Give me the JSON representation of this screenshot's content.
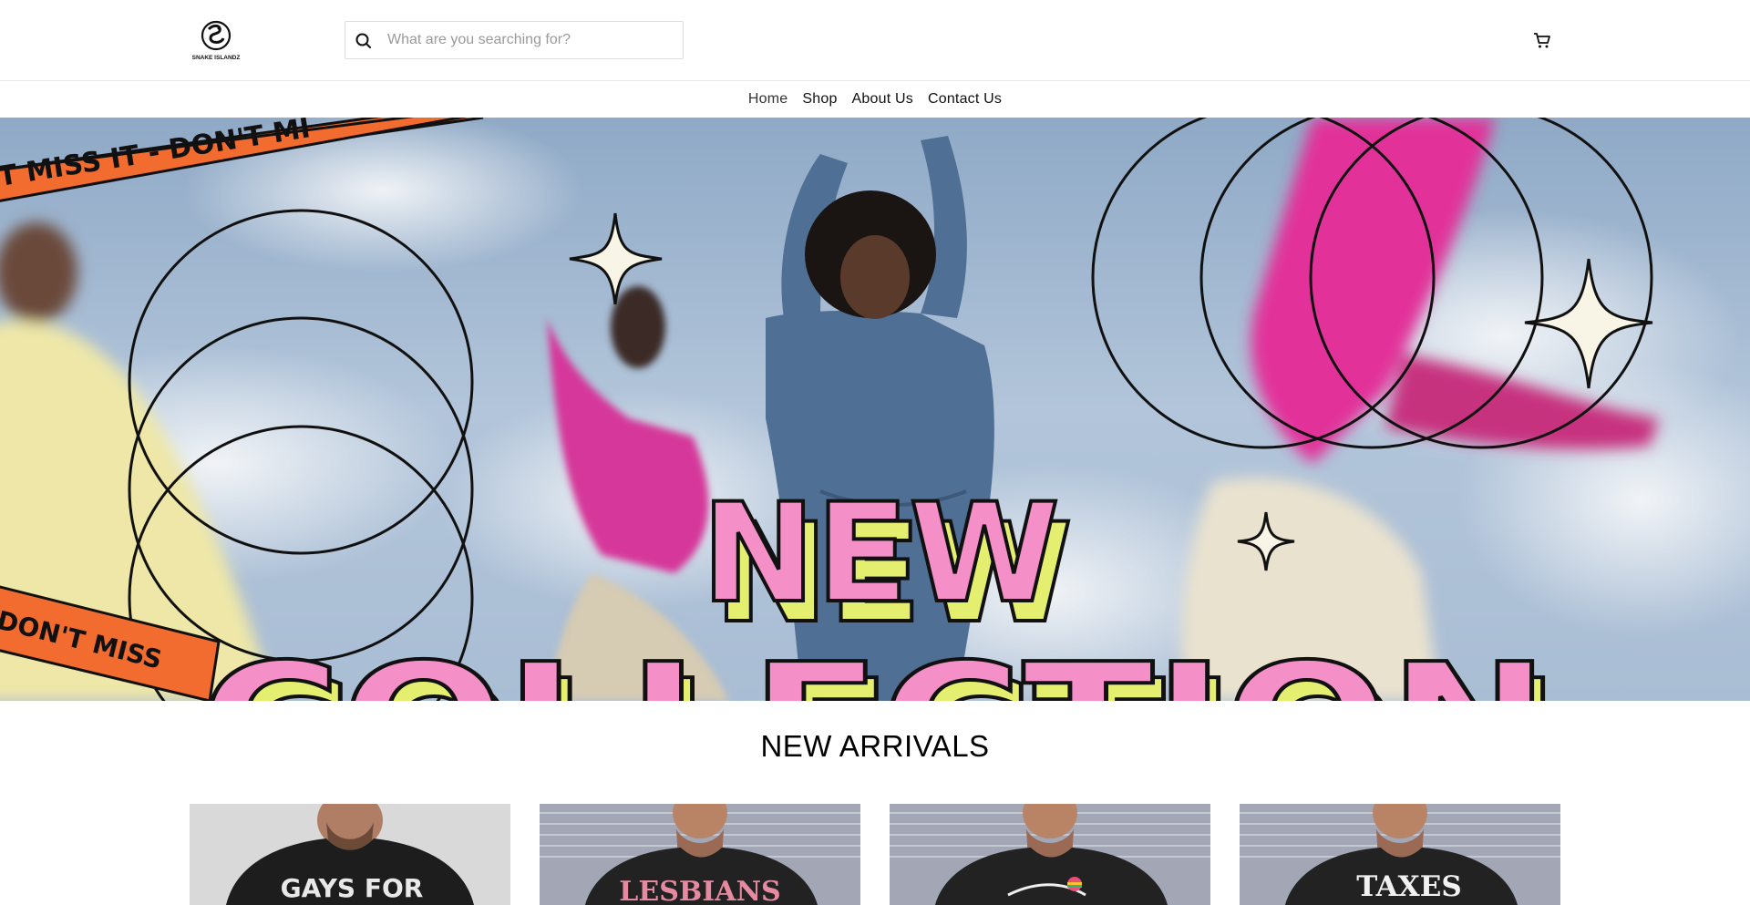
{
  "header": {
    "logo_text": "SNAKE ISLANDZ",
    "search": {
      "placeholder": "What are you searching for?",
      "value": ""
    }
  },
  "nav": {
    "items": [
      {
        "label": "Home",
        "active": true
      },
      {
        "label": "Shop"
      },
      {
        "label": "About Us"
      },
      {
        "label": "Contact Us"
      }
    ]
  },
  "hero": {
    "banner_text_top": "T MISS IT - DON'T MI",
    "banner_text_bottom": "DON'T MISS",
    "headline_line1": "NEW",
    "headline_line2": "COLLECTION",
    "colors": {
      "pink": "#f48fc7",
      "yellow": "#e4ee6f",
      "orange": "#f26b2f",
      "sky": "#9fb8d3"
    }
  },
  "new_arrivals": {
    "title": "NEW ARRIVALS",
    "products": [
      {
        "shirt_text": "GAYS FOR"
      },
      {
        "shirt_text": "LESBIANS"
      },
      {
        "shirt_text": ""
      },
      {
        "shirt_text": "TAXES"
      }
    ]
  }
}
